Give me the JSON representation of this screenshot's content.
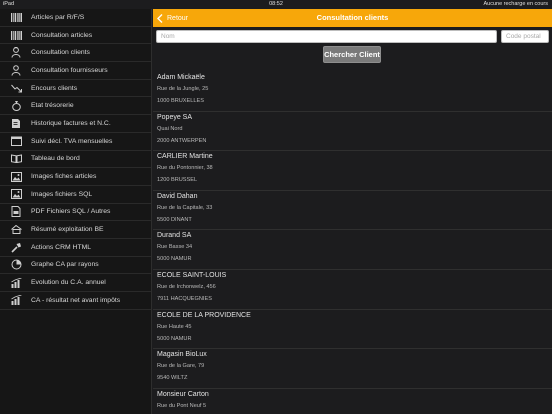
{
  "status_bar": {
    "device": "iPad",
    "time": "08:52",
    "right": "Aucune recharge en cours"
  },
  "sidebar": {
    "items": [
      {
        "label": "Articles par R/F/S",
        "icon": "barcode-icon"
      },
      {
        "label": "Consultation articles",
        "icon": "barcode-icon"
      },
      {
        "label": "Consultation clients",
        "icon": "client-icon"
      },
      {
        "label": "Consultation fournisseurs",
        "icon": "supplier-icon"
      },
      {
        "label": "Encours clients",
        "icon": "trend-icon"
      },
      {
        "label": "Etat trésorerie",
        "icon": "money-bag-icon"
      },
      {
        "label": "Historique factures et N.C.",
        "icon": "invoice-icon"
      },
      {
        "label": "Suivi décl. TVA mensuelles",
        "icon": "calendar-icon"
      },
      {
        "label": "Tableau de bord",
        "icon": "book-icon"
      },
      {
        "label": "Images fiches articles",
        "icon": "image-icon"
      },
      {
        "label": "Images fichiers SQL",
        "icon": "image-icon"
      },
      {
        "label": "PDF Fichiers SQL / Autres",
        "icon": "pdf-icon"
      },
      {
        "label": "Résumé exploitation BE",
        "icon": "summary-icon"
      },
      {
        "label": "Actions CRM HTML",
        "icon": "tools-icon"
      },
      {
        "label": "Graphe CA par rayons",
        "icon": "pie-chart-icon"
      },
      {
        "label": "Evolution du C.A. annuel",
        "icon": "bar-chart-icon"
      },
      {
        "label": "CA - résultat net avant impôts",
        "icon": "bar-chart-icon"
      }
    ]
  },
  "navbar": {
    "back_label": "Retour",
    "title": "Consultation clients"
  },
  "search": {
    "name_placeholder": "Nom",
    "postal_placeholder": "Code postal",
    "button_label": "Chercher Client"
  },
  "clients": [
    {
      "name": "Adam Mickaële",
      "street": "Rue de la Jungle, 25",
      "city": "1000 BRUXELLES"
    },
    {
      "name": "Popeye SA",
      "street": "Quai Nord",
      "city": "2000 ANTWERPEN"
    },
    {
      "name": "CARLIER Martine",
      "street": "Rue du Pontonnier, 38",
      "city": "1200 BRUSSEL"
    },
    {
      "name": "David Dahan",
      "street": "Rue de la Capitale, 33",
      "city": "5500 DINANT"
    },
    {
      "name": "Durand SA",
      "street": "Rue Basse 34",
      "city": "5000 NAMUR"
    },
    {
      "name": "ECOLE SAINT-LOUIS",
      "street": "Rue de Irchonwelz, 456",
      "city": "7911 HACQUEGNIES"
    },
    {
      "name": "ECOLE DE LA PROVIDENCE",
      "street": "Rue Haute 45",
      "city": "5000 NAMUR"
    },
    {
      "name": "Magasin BioLux",
      "street": "Rue de la Gare, 79",
      "city": "9540 WILTZ"
    },
    {
      "name": "Monsieur Carton",
      "street": "Rue du Pont Neuf 5",
      "city": ""
    }
  ]
}
